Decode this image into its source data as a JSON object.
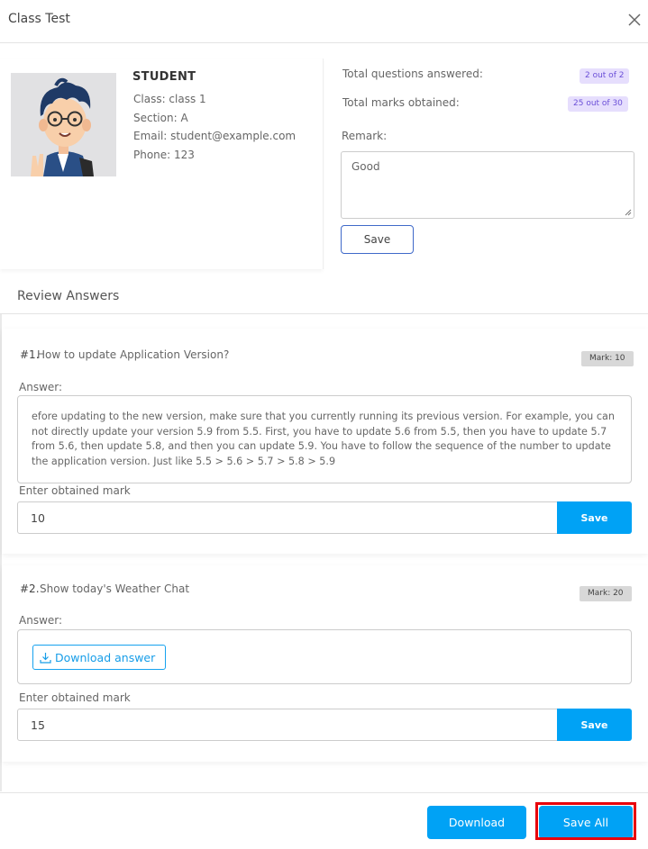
{
  "header": {
    "title": "Class Test",
    "close_icon": "close-icon"
  },
  "student": {
    "name": "STUDENT",
    "class_line": "Class: class 1",
    "section_line": "Section: A",
    "email_line": "Email: student@example.com",
    "phone_line": "Phone: 123",
    "avatar_icon": "student-avatar-illustration"
  },
  "summary": {
    "questions_label": "Total questions answered:",
    "questions_value": "2 out of 2",
    "marks_label": "Total marks obtained:",
    "marks_value": "25 out of 30",
    "badge_color": "#e6defd"
  },
  "remark": {
    "label": "Remark:",
    "value": "Good",
    "save_label": "Save"
  },
  "review": {
    "title": "Review Answers"
  },
  "questions": [
    {
      "number": "#1.",
      "text": "How to update Application Version?",
      "mark_badge": "Mark: 10",
      "answer_label": "Answer:",
      "answer_text": "efore updating to the new version, make sure that you currently running its previous version. For example, you can not directly update your version 5.9 from 5.5. First, you have to update 5.6 from 5.5, then you have to update 5.7 from 5.6, then update 5.8, and then you can update 5.9. You have to follow the sequence of the number to update the application version. Just like 5.5 > 5.6 > 5.7 > 5.8 > 5.9",
      "mark_label": "Enter obtained mark",
      "mark_value": "10",
      "save_label": "Save"
    },
    {
      "number": "#2.",
      "text": "Show today's Weather Chat",
      "mark_badge": "Mark: 20",
      "answer_label": "Answer:",
      "download_label": "Download answer",
      "mark_label": "Enter obtained mark",
      "mark_value": "15",
      "save_label": "Save"
    }
  ],
  "footer": {
    "download_label": "Download",
    "save_all_label": "Save All"
  },
  "colors": {
    "primary": "#00a2f5",
    "highlight": "#e8000b",
    "outline_button": "#3f69c9"
  }
}
